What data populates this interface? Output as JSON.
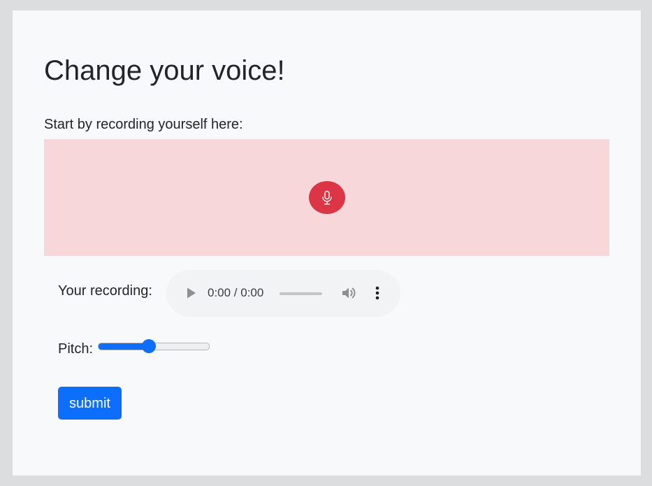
{
  "page": {
    "title": "Change your voice!",
    "intro_text": "Start by recording yourself here:"
  },
  "recorder": {
    "icon": "microphone-icon",
    "accent_color": "#dc3545",
    "zone_color": "#f8d7da"
  },
  "playback": {
    "label": "Your recording:",
    "time": "0:00 / 0:00",
    "play_icon": "play-icon",
    "volume_icon": "volume-icon",
    "more_icon": "more-options-icon"
  },
  "pitch": {
    "label": "Pitch:",
    "value_fraction": 0.45
  },
  "form": {
    "submit_label": "submit",
    "accent_color": "#0d6efd"
  }
}
